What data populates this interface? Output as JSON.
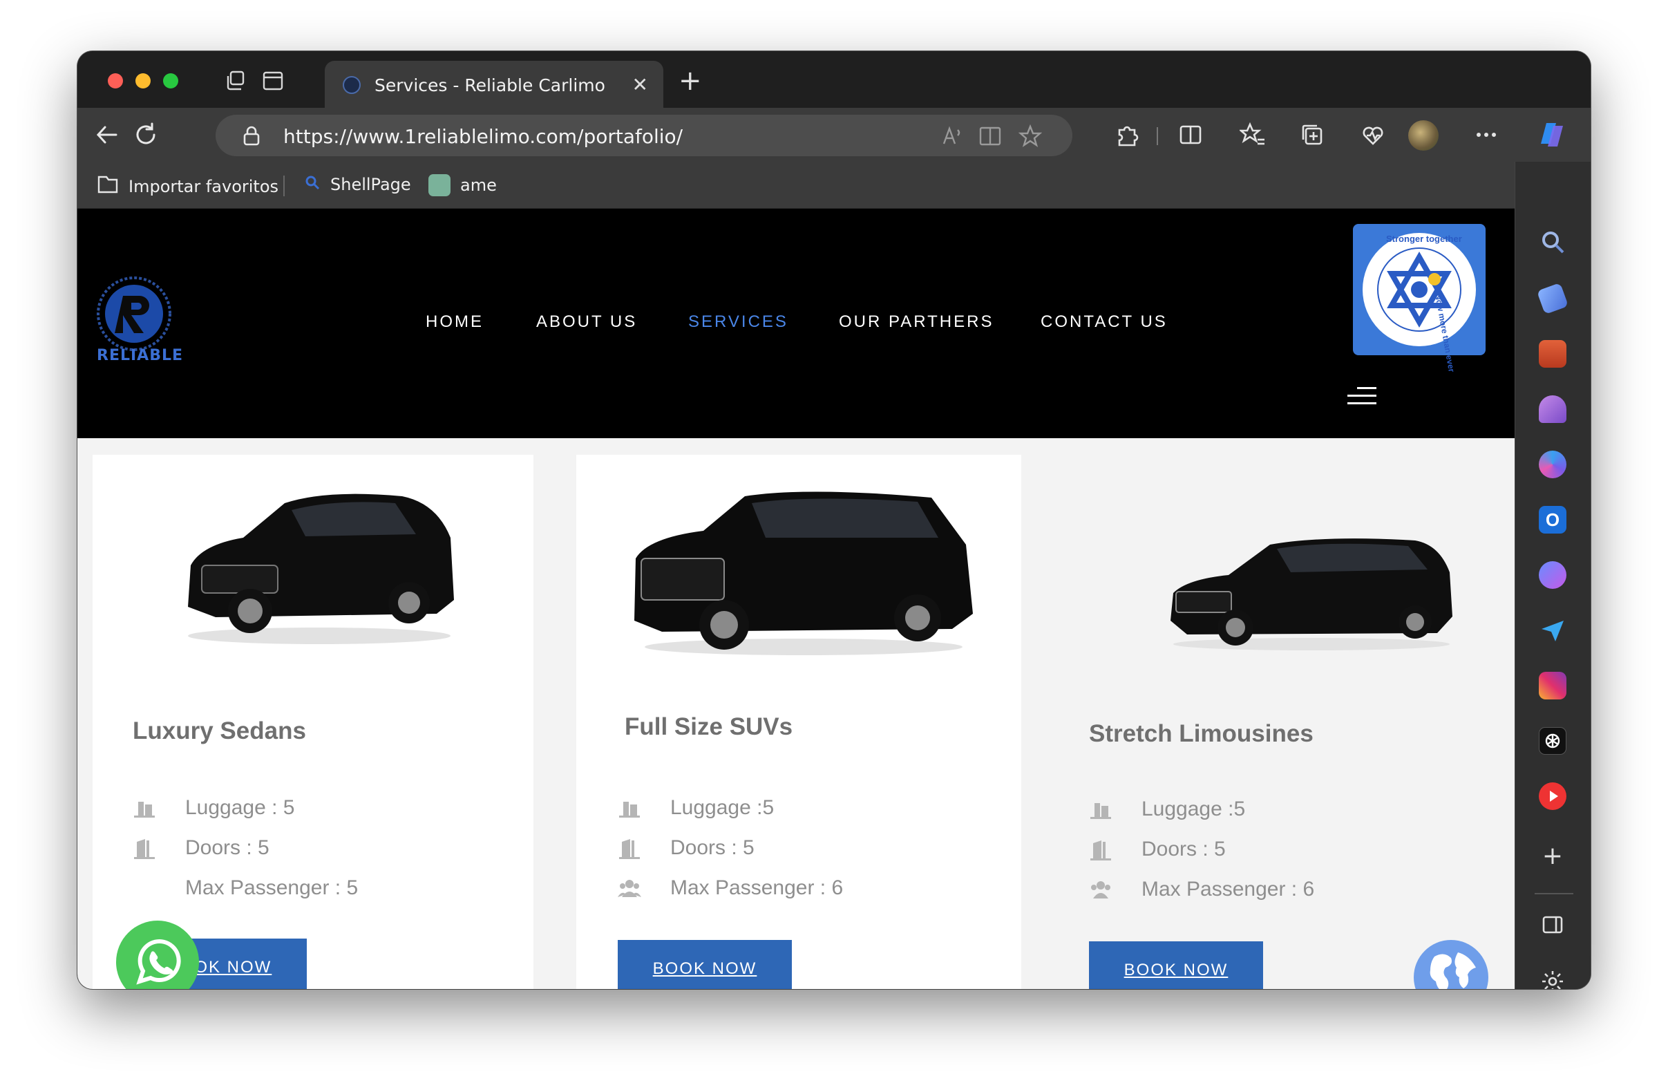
{
  "browser": {
    "tab_title": "Services - Reliable Carlimo",
    "url": "https://www.1reliablelimo.com/portafolio/",
    "favorites": [
      {
        "label": "Importar favoritos"
      },
      {
        "label": "ShellPage"
      },
      {
        "label": "ame"
      }
    ]
  },
  "site": {
    "logo_text": "RELIABLE",
    "logo_ring_text": "Luxury Car and Limousine Service",
    "badge_text_top": "Stronger together",
    "badge_text_right": "Now more than ever",
    "nav": [
      {
        "label": "HOME",
        "active": false
      },
      {
        "label": "ABOUT US",
        "active": false
      },
      {
        "label": "SERVICES",
        "active": true
      },
      {
        "label": "OUR PARTHERS",
        "active": false
      },
      {
        "label": "CONTACT US",
        "active": false
      }
    ],
    "accent_color": "#4a86e8",
    "button_color": "#2e67b6"
  },
  "cards": [
    {
      "title": "Luxury Sedans",
      "luggage": "Luggage : 5",
      "doors": "Doors : 5",
      "passengers": "Max Passenger : 5",
      "button": "BOOK NOW"
    },
    {
      "title": "Full Size SUVs",
      "luggage": "Luggage :5",
      "doors": "Doors : 5",
      "passengers": "Max Passenger : 6",
      "button": "BOOK NOW"
    },
    {
      "title": "Stretch Limousines",
      "luggage": "Luggage :5",
      "doors": "Doors : 5",
      "passengers": "Max Passenger : 6",
      "button": "BOOK NOW"
    }
  ]
}
